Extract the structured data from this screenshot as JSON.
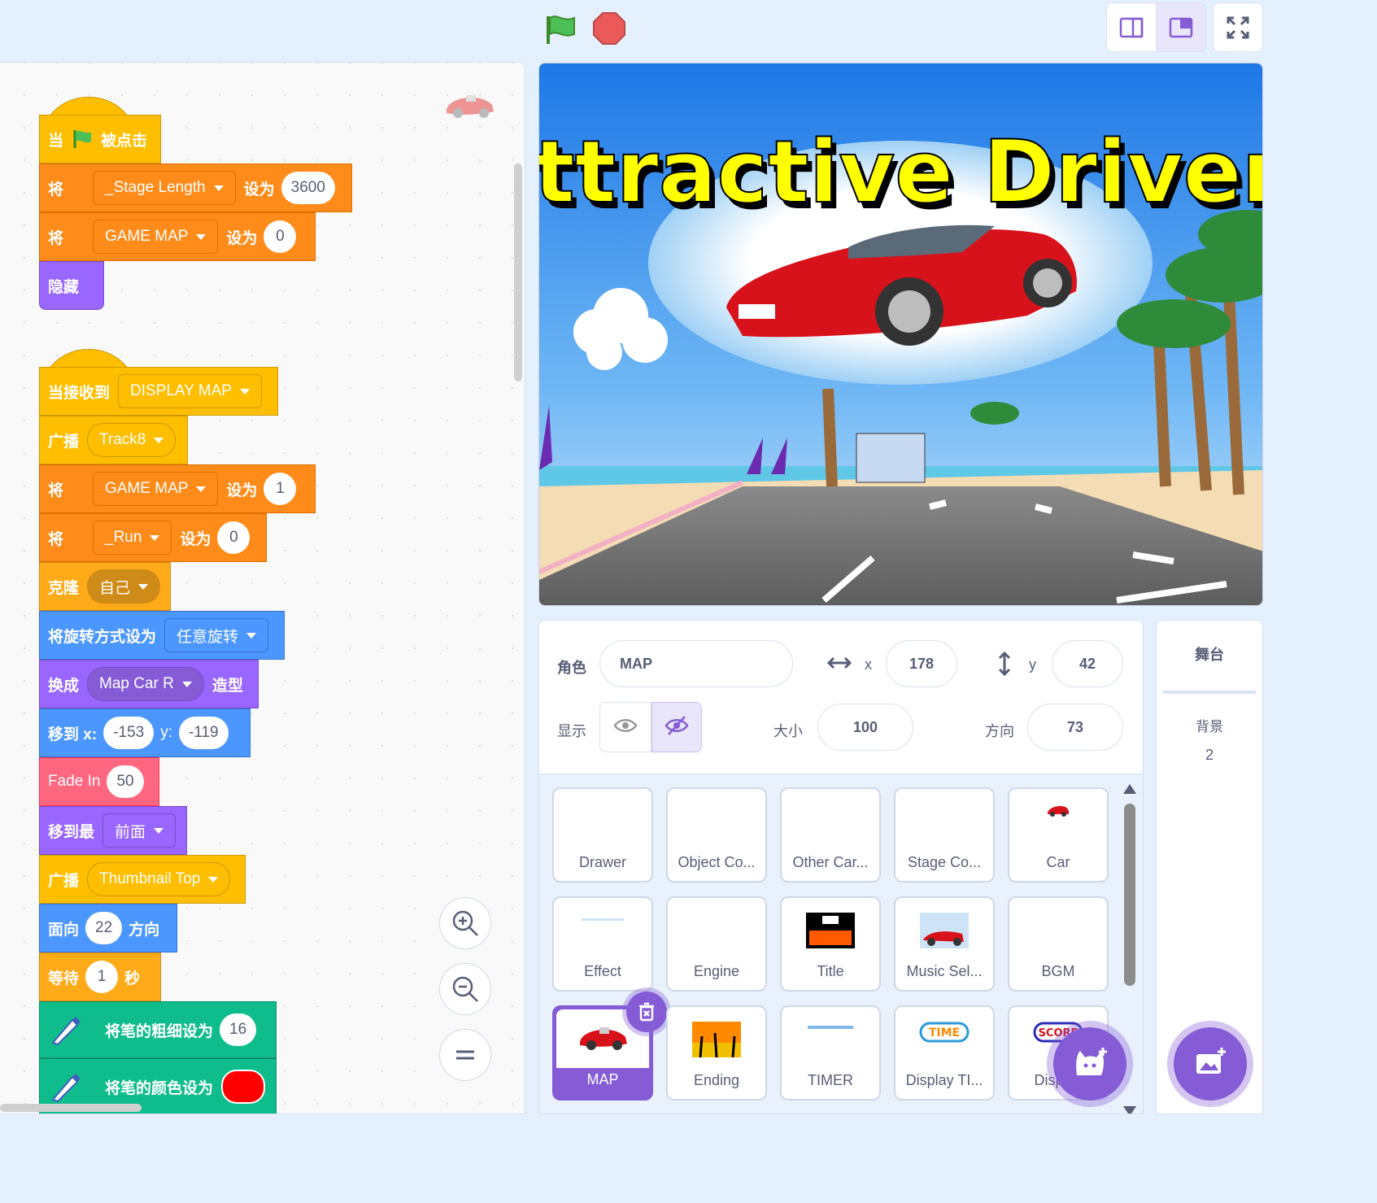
{
  "toolbar": {
    "flag": "green-flag-icon",
    "stop": "stop-icon",
    "modes": [
      "small-stage-mode-icon",
      "normal-stage-mode-icon",
      "fullscreen-icon"
    ]
  },
  "scripts": {
    "script1": {
      "hat_when": "当",
      "hat_clicked": "被点击",
      "set1_label": "将",
      "set1_var": "_Stage Length",
      "set1_to": "设为",
      "set1_val": "3600",
      "set2_label": "将",
      "set2_var": "GAME MAP",
      "set2_to": "设为",
      "set2_val": "0",
      "hide": "隐藏"
    },
    "script2": {
      "hat": "当接收到",
      "hat_msg": "DISPLAY MAP",
      "bc1_label": "广播",
      "bc1_msg": "Track8",
      "set1_label": "将",
      "set1_var": "GAME MAP",
      "set1_to": "设为",
      "set1_val": "1",
      "set2_label": "将",
      "set2_var": "_Run",
      "set2_to": "设为",
      "set2_val": "0",
      "clone_label": "克隆",
      "clone_target": "自己",
      "rot_label": "将旋转方式设为",
      "rot_val": "任意旋转",
      "costume_label": "换成",
      "costume_val": "Map Car R",
      "costume_suffix": "造型",
      "goto_label": "移到 x:",
      "goto_x": "-153",
      "goto_y_label": "y:",
      "goto_y": "-119",
      "fade_label": "Fade In",
      "fade_val": "50",
      "layer_label": "移到最",
      "layer_val": "前面",
      "bc2_label": "广播",
      "bc2_msg": "Thumbnail Top",
      "dir_label": "面向",
      "dir_val": "22",
      "dir_suffix": "方向",
      "wait_label": "等待",
      "wait_val": "1",
      "wait_suffix": "秒",
      "pen_size_label": "将笔的粗细设为",
      "pen_size_val": "16",
      "pen_color_label": "将笔的颜色设为",
      "pen_color": "#ff0000"
    }
  },
  "zoom": [
    "zoom-in-icon",
    "zoom-out-icon",
    "zoom-reset-icon"
  ],
  "stage": {
    "title_art": "Attractive Drivers"
  },
  "sprite_info": {
    "sprite_label": "角色",
    "sprite_name": "MAP",
    "x_label": "x",
    "x_val": "178",
    "y_label": "y",
    "y_val": "42",
    "show_label": "显示",
    "size_label": "大小",
    "size_val": "100",
    "dir_label": "方向",
    "dir_val": "73"
  },
  "sprites": [
    {
      "name": "Drawer"
    },
    {
      "name": "Object Co..."
    },
    {
      "name": "Other Car..."
    },
    {
      "name": "Stage Co..."
    },
    {
      "name": "Car"
    },
    {
      "name": "Effect"
    },
    {
      "name": "Engine"
    },
    {
      "name": "Title"
    },
    {
      "name": "Music Sel..."
    },
    {
      "name": "BGM"
    },
    {
      "name": "MAP",
      "selected": true
    },
    {
      "name": "Ending"
    },
    {
      "name": "TIMER"
    },
    {
      "name": "Display TI..."
    },
    {
      "name": "Display"
    }
  ],
  "stage_pane": {
    "title": "舞台",
    "backdrops_label": "背景",
    "backdrops_count": "2"
  },
  "colors": {
    "accent": "#855cd6",
    "events": "#ffbf00",
    "variables": "#ff8c1a",
    "looks": "#9966ff",
    "motion": "#4c97ff",
    "control": "#ffab19",
    "pen": "#0fbd8c"
  }
}
